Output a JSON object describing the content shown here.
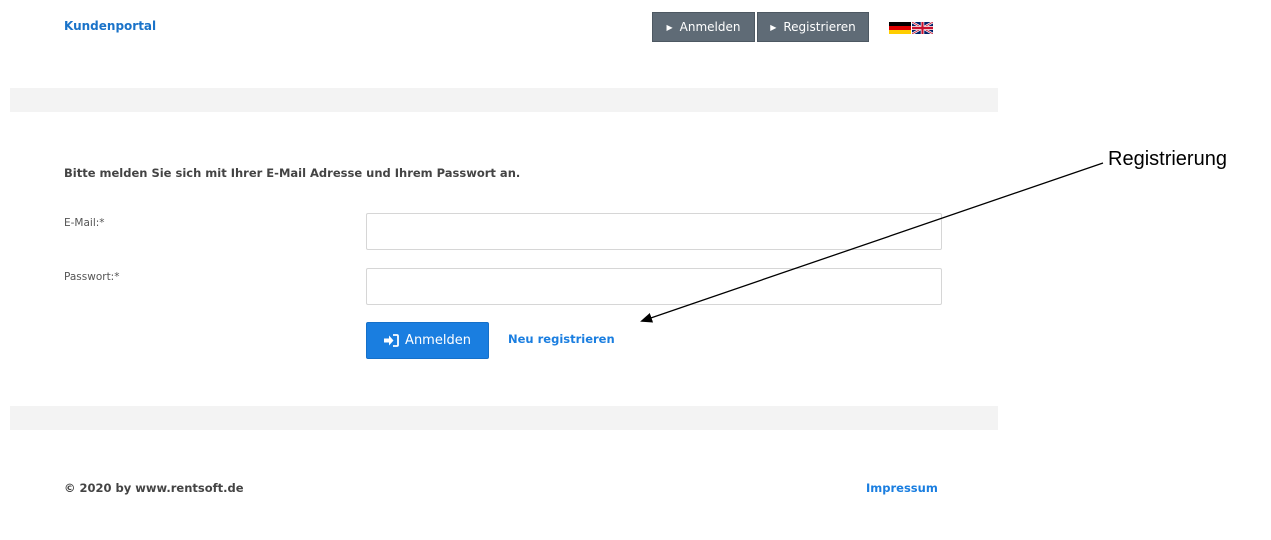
{
  "header": {
    "brand": "Kundenportal",
    "nav": {
      "login_label": "Anmelden",
      "register_label": "Registrieren"
    },
    "languages": [
      {
        "code": "de",
        "icon": "flag-de-icon"
      },
      {
        "code": "en",
        "icon": "flag-uk-icon"
      }
    ]
  },
  "form": {
    "instruction": "Bitte melden Sie sich mit Ihrer E-Mail Adresse und Ihrem Passwort an.",
    "email_label": "E-Mail:*",
    "email_value": "",
    "password_label": "Passwort:*",
    "password_value": "",
    "submit_label": "Anmelden",
    "submit_icon": "sign-in-icon",
    "register_link": "Neu registrieren"
  },
  "footer": {
    "copyright": "© 2020 by www.rentsoft.de",
    "impressum": "Impressum"
  },
  "annotation": {
    "label": "Registrierung"
  },
  "colors": {
    "accent": "#1a7ee0",
    "nav_button": "#5f6b76",
    "band": "#f3f3f3"
  }
}
